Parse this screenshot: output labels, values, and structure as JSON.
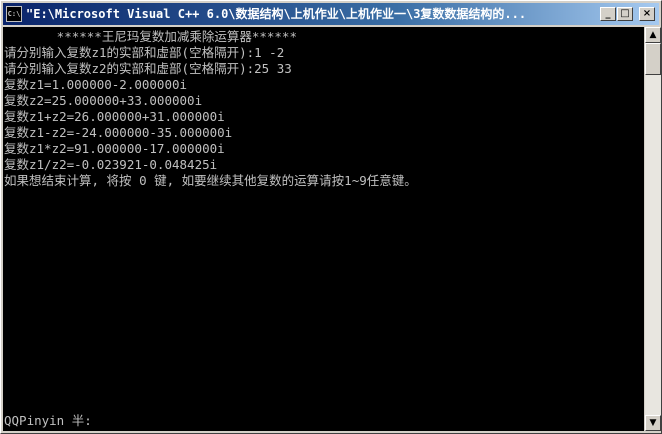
{
  "window": {
    "title": "\"E:\\Microsoft Visual C++ 6.0\\数据结构\\上机作业\\上机作业一\\3复数数据结构的...",
    "icon_label": "C:\\",
    "minimize_glyph": "_",
    "maximize_glyph": "□",
    "close_glyph": "×"
  },
  "console": {
    "lines": [
      "       ******王尼玛复数加减乘除运算器******",
      "请分别输入复数z1的实部和虚部(空格隔开):1 -2",
      "请分别输入复数z2的实部和虚部(空格隔开):25 33",
      "复数z1=1.000000-2.000000i",
      "复数z2=25.000000+33.000000i",
      "复数z1+z2=26.000000+31.000000i",
      "复数z1-z2=-24.000000-35.000000i",
      "复数z1*z2=91.000000-17.000000i",
      "复数z1/z2=-0.023921-0.048425i",
      "如果想结束计算, 将按 0 键, 如要继续其他复数的运算请按1~9任意键。"
    ],
    "ime_status": "QQPinyin 半:"
  },
  "scrollbar": {
    "up_glyph": "▲",
    "down_glyph": "▼"
  }
}
